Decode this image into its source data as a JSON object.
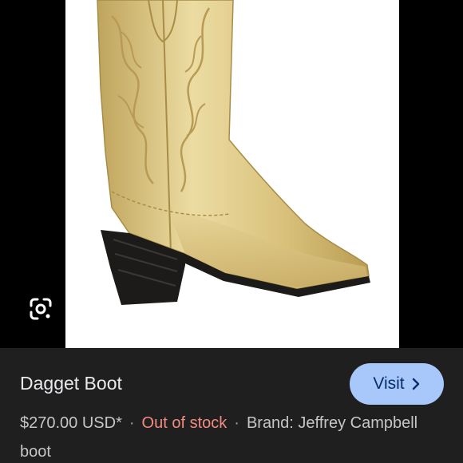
{
  "product": {
    "title": "Dagget Boot",
    "price": "$270.00 USD*",
    "stock_status": "Out of stock",
    "brand": "Brand: Jeffrey Campbell",
    "category": "boot",
    "separator": "·"
  },
  "actions": {
    "visit_label": "Visit"
  },
  "icons": {
    "lens": "google-lens-icon",
    "visit_chevron": "chevron-right-icon"
  },
  "colors": {
    "panel_background": "#1f1f1f",
    "visit_button": "#a8c7fa",
    "stock_text": "#f28b82",
    "boot_gold": "#d9c27a",
    "boot_heel": "#1c1b19"
  }
}
